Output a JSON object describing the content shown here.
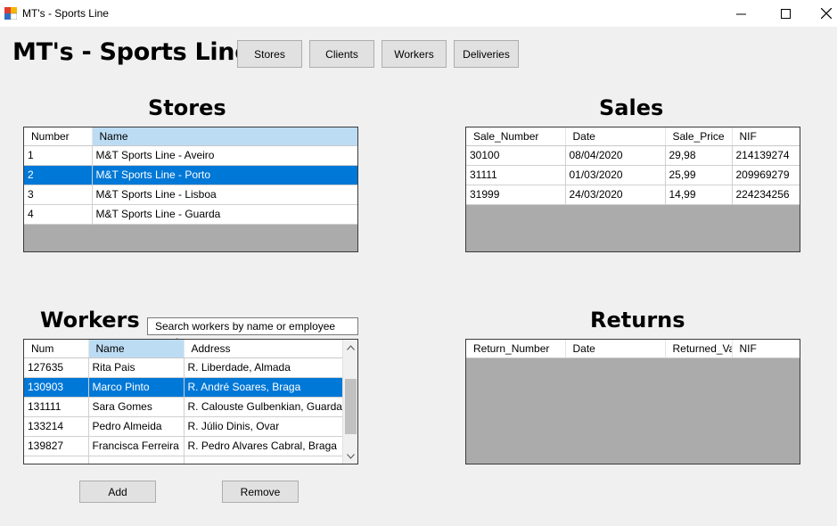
{
  "window": {
    "title": "MT's - Sports Line"
  },
  "header": {
    "title": "MT's - Sports Line",
    "nav": [
      "Stores",
      "Clients",
      "Workers",
      "Deliveries"
    ]
  },
  "stores": {
    "title": "Stores",
    "columns": [
      "Number",
      "Name"
    ],
    "rows": [
      [
        "1",
        "M&T Sports Line - Aveiro"
      ],
      [
        "2",
        "M&T Sports Line - Porto"
      ],
      [
        "3",
        "M&T Sports Line - Lisboa"
      ],
      [
        "4",
        "M&T Sports Line - Guarda"
      ]
    ],
    "selected_row": 1
  },
  "sales": {
    "title": "Sales",
    "columns": [
      "Sale_Number",
      "Date",
      "Sale_Price",
      "NIF"
    ],
    "rows": [
      [
        "30100",
        "08/04/2020",
        "29,98",
        "214139274"
      ],
      [
        "31111",
        "01/03/2020",
        "25,99",
        "209969279"
      ],
      [
        "31999",
        "24/03/2020",
        "14,99",
        "224234256"
      ]
    ]
  },
  "workers": {
    "title": "Workers",
    "search_text": "Search workers by name or employee number",
    "columns": [
      "Num",
      "Name",
      "Address"
    ],
    "rows": [
      [
        "127635",
        "Rita Pais",
        "R. Liberdade, Almada"
      ],
      [
        "130903",
        "Marco Pinto",
        "R. André Soares, Braga"
      ],
      [
        "131111",
        "Sara Gomes",
        "R. Calouste Gulbenkian, Guarda"
      ],
      [
        "133214",
        "Pedro Almeida",
        "R. Júlio Dinis, Ovar"
      ],
      [
        "139827",
        "Francisca Ferreira",
        "R. Pedro Alvares Cabral, Braga"
      ]
    ],
    "selected_row": 1,
    "add_label": "Add",
    "remove_label": "Remove"
  },
  "returns": {
    "title": "Returns",
    "columns": [
      "Return_Number",
      "Date",
      "Returned_Value",
      "NIF"
    ]
  },
  "colors": {
    "selection": "#0078d7",
    "active_header": "#bcdcf4",
    "grid_background": "#ababab"
  }
}
